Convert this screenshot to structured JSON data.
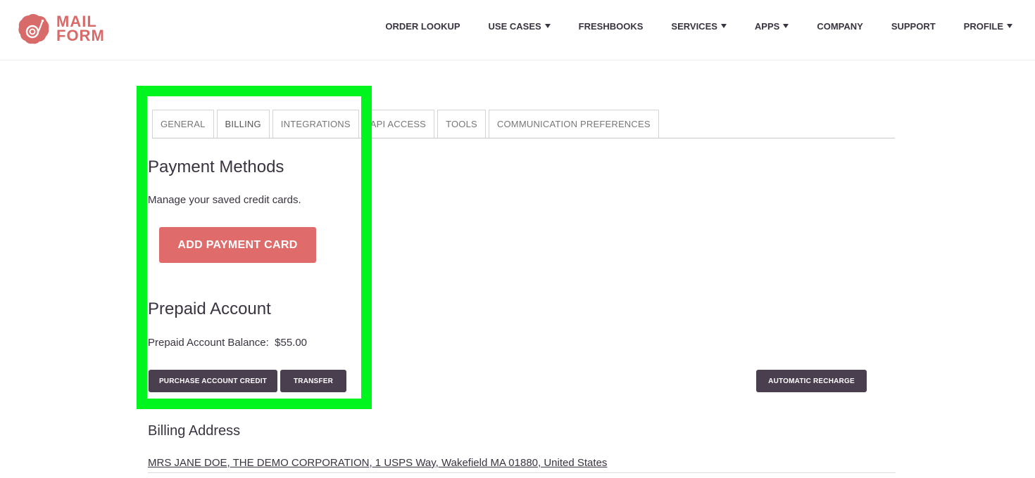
{
  "brand": {
    "line1": "MAIL",
    "line2": "FORM",
    "color": "#d86a6a"
  },
  "nav": [
    {
      "label": "ORDER LOOKUP",
      "dropdown": false
    },
    {
      "label": "USE CASES",
      "dropdown": true
    },
    {
      "label": "FRESHBOOKS",
      "dropdown": false
    },
    {
      "label": "SERVICES",
      "dropdown": true
    },
    {
      "label": "APPS",
      "dropdown": true
    },
    {
      "label": "COMPANY",
      "dropdown": false
    },
    {
      "label": "SUPPORT",
      "dropdown": false
    },
    {
      "label": "PROFILE",
      "dropdown": true
    }
  ],
  "tabs": [
    "GENERAL",
    "BILLING",
    "INTEGRATIONS",
    "API ACCESS",
    "TOOLS",
    "COMMUNICATION PREFERENCES"
  ],
  "active_tab": "BILLING",
  "payment": {
    "title": "Payment Methods",
    "description": "Manage your saved credit cards.",
    "add_button": "ADD PAYMENT CARD"
  },
  "prepaid": {
    "title": "Prepaid Account",
    "balance_label": "Prepaid Account Balance:",
    "balance_value": "$55.00",
    "purchase_button": "PURCHASE ACCOUNT CREDIT",
    "transfer_button": "TRANSFER",
    "recharge_button": "AUTOMATIC RECHARGE"
  },
  "billing_address": {
    "title": "Billing Address",
    "value": "MRS JANE DOE, THE DEMO CORPORATION, 1 USPS Way, Wakefield MA 01880, United States"
  },
  "colors": {
    "accent": "#e06b6b",
    "dark_button": "#4a3f4f",
    "highlight": "#00f51e"
  }
}
